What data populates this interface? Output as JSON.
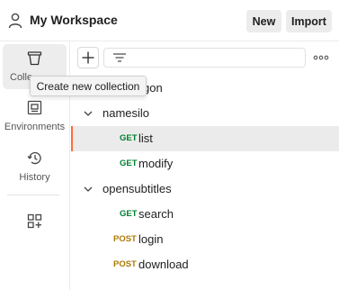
{
  "header": {
    "workspace_title": "My Workspace",
    "new_label": "New",
    "import_label": "Import"
  },
  "sidebar": {
    "items": [
      {
        "label": "Collections",
        "icon": "trash-can-icon",
        "active": true
      },
      {
        "label": "Environments",
        "icon": "environment-icon",
        "active": false
      },
      {
        "label": "History",
        "icon": "history-icon",
        "active": false
      },
      {
        "label": "",
        "icon": "add-workbench-icon",
        "active": false
      }
    ],
    "collections_visible_label": "Colle"
  },
  "tooltip": {
    "text": "Create new collection"
  },
  "tree": {
    "partial_row_text": "gon",
    "folders": [
      {
        "name": "namesilo",
        "expanded": true
      },
      {
        "name": "opensubtitles",
        "expanded": true
      }
    ],
    "requests": [
      {
        "method": "GET",
        "name": "list",
        "selected": true
      },
      {
        "method": "GET",
        "name": "modify",
        "selected": false
      },
      {
        "method": "GET",
        "name": "search",
        "selected": false
      },
      {
        "method": "POST",
        "name": "login",
        "selected": false
      },
      {
        "method": "POST",
        "name": "download",
        "selected": false
      }
    ]
  },
  "colors": {
    "get": "#007f31",
    "post": "#ad7a03",
    "accent": "#ff6c37"
  }
}
